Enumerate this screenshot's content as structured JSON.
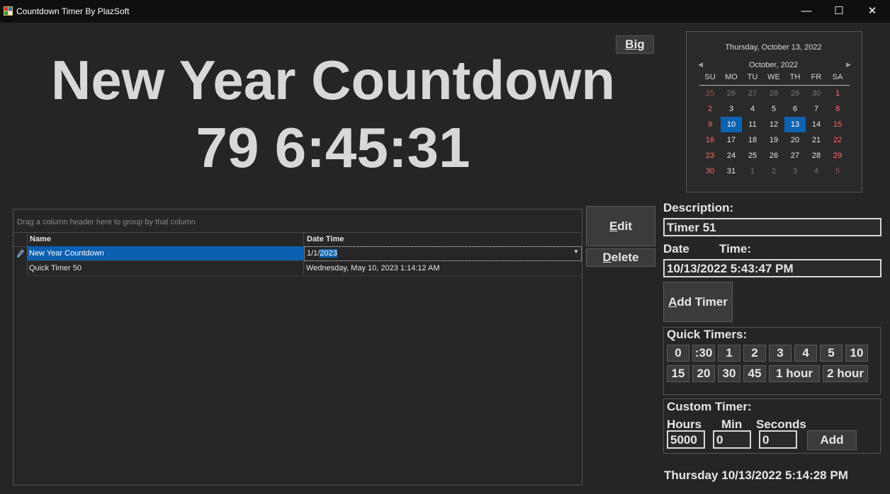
{
  "window": {
    "title": "Countdown Timer By PlazSoft",
    "controls": {
      "minimize": "—",
      "maximize": "☐",
      "close": "✕"
    }
  },
  "display": {
    "timer_name": "New Year Countdown",
    "countdown": "79 6:45:31",
    "big_button": "Big"
  },
  "calendar": {
    "today_label": "Thursday, October 13, 2022",
    "month_label": "October, 2022",
    "day_headers": [
      "SU",
      "MO",
      "TU",
      "WE",
      "TH",
      "FR",
      "SA"
    ],
    "weeks": [
      [
        "25",
        "26",
        "27",
        "28",
        "29",
        "30",
        "1"
      ],
      [
        "2",
        "3",
        "4",
        "5",
        "6",
        "7",
        "8"
      ],
      [
        "9",
        "10",
        "11",
        "12",
        "13",
        "14",
        "15"
      ],
      [
        "16",
        "17",
        "18",
        "19",
        "20",
        "21",
        "22"
      ],
      [
        "23",
        "24",
        "25",
        "26",
        "27",
        "28",
        "29"
      ],
      [
        "30",
        "31",
        "1",
        "2",
        "3",
        "4",
        "5"
      ]
    ],
    "selected_days": [
      "10",
      "13"
    ],
    "weekend_color": "#ff6b6b",
    "selection_color": "#0f62b0"
  },
  "grid": {
    "group_hint": "Drag a column header here to group by that column",
    "columns": [
      "Name",
      "Date Time"
    ],
    "rows": [
      {
        "name": "New Year Countdown",
        "datetime_prefix": "1/1/",
        "datetime_selected": "2023"
      },
      {
        "name": "Quick Timer 50",
        "datetime": "Wednesday, May 10, 2023 1:14:12 AM"
      }
    ]
  },
  "actions": {
    "edit_prefix": "E",
    "edit_rest": "dit",
    "delete_prefix": "D",
    "delete_rest": "elete",
    "add_timer_prefix": "A",
    "add_timer_rest": "dd Timer"
  },
  "form": {
    "description_label": "Description:",
    "description_value": "Timer 51",
    "date_label": "Date",
    "time_label": "Time:",
    "datetime_value": "10/13/2022 5:43:47 PM"
  },
  "quick_timers": {
    "title": "Quick Timers:",
    "row1": [
      "0",
      ":30",
      "1",
      "2",
      "3",
      "4",
      "5",
      "10"
    ],
    "row2": [
      "15",
      "20",
      "30",
      "45",
      "1 hour",
      "2 hour"
    ]
  },
  "custom_timer": {
    "title": "Custom Timer:",
    "hours_label": "Hours",
    "min_label": "Min",
    "seconds_label": "Seconds",
    "hours_value": "5000",
    "min_value": "0",
    "seconds_value": "0",
    "add_label": "Add"
  },
  "status": {
    "current_datetime": "Thursday 10/13/2022 5:14:28 PM"
  }
}
